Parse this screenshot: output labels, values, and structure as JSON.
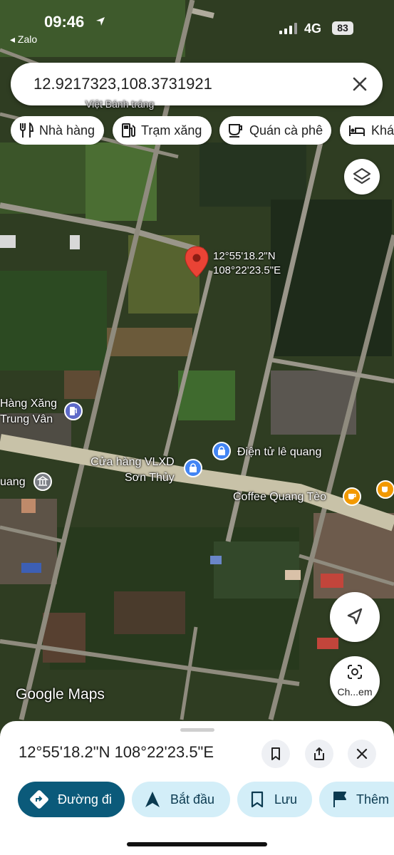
{
  "status_bar": {
    "time": "09:46",
    "back_app": "◂ Zalo",
    "network": "4G",
    "battery": "83"
  },
  "search": {
    "value": "12.9217323,108.3731921"
  },
  "chips": [
    {
      "label": "Nhà hàng",
      "icon": "restaurant-icon"
    },
    {
      "label": "Trạm xăng",
      "icon": "gas-station-icon"
    },
    {
      "label": "Quán cà phê",
      "icon": "coffee-icon"
    },
    {
      "label": "Khác",
      "icon": "hotel-icon"
    }
  ],
  "pin": {
    "lat_label": "12°55'18.2\"N",
    "lng_label": "108°22'23.5\"E"
  },
  "places": {
    "partial_top": "Việt Bánh tráng",
    "gas_line1": "Hàng Xăng",
    "gas_line2": "Trung Vân",
    "vlxd_line1": "Cửa hàng VLXD",
    "vlxd_line2": "Sơn Thủy",
    "dien_tu": "Điện tử lê quang",
    "coffee": "Coffee Quang Tèo",
    "quang": "uang"
  },
  "camera_label": "Ch...em",
  "brand": "Google Maps",
  "sheet": {
    "coordinates": "12°55'18.2\"N 108°22'23.5\"E"
  },
  "actions": {
    "directions": "Đường đi",
    "start": "Bắt đầu",
    "save": "Lưu",
    "more": "Thêm"
  },
  "colors": {
    "accent": "#0b57d0",
    "action_dark": "#0b5a7a",
    "action_light": "#d3eef8",
    "pin": "#ea4335",
    "poi_blue": "#4285f4",
    "poi_orange": "#f29900"
  }
}
